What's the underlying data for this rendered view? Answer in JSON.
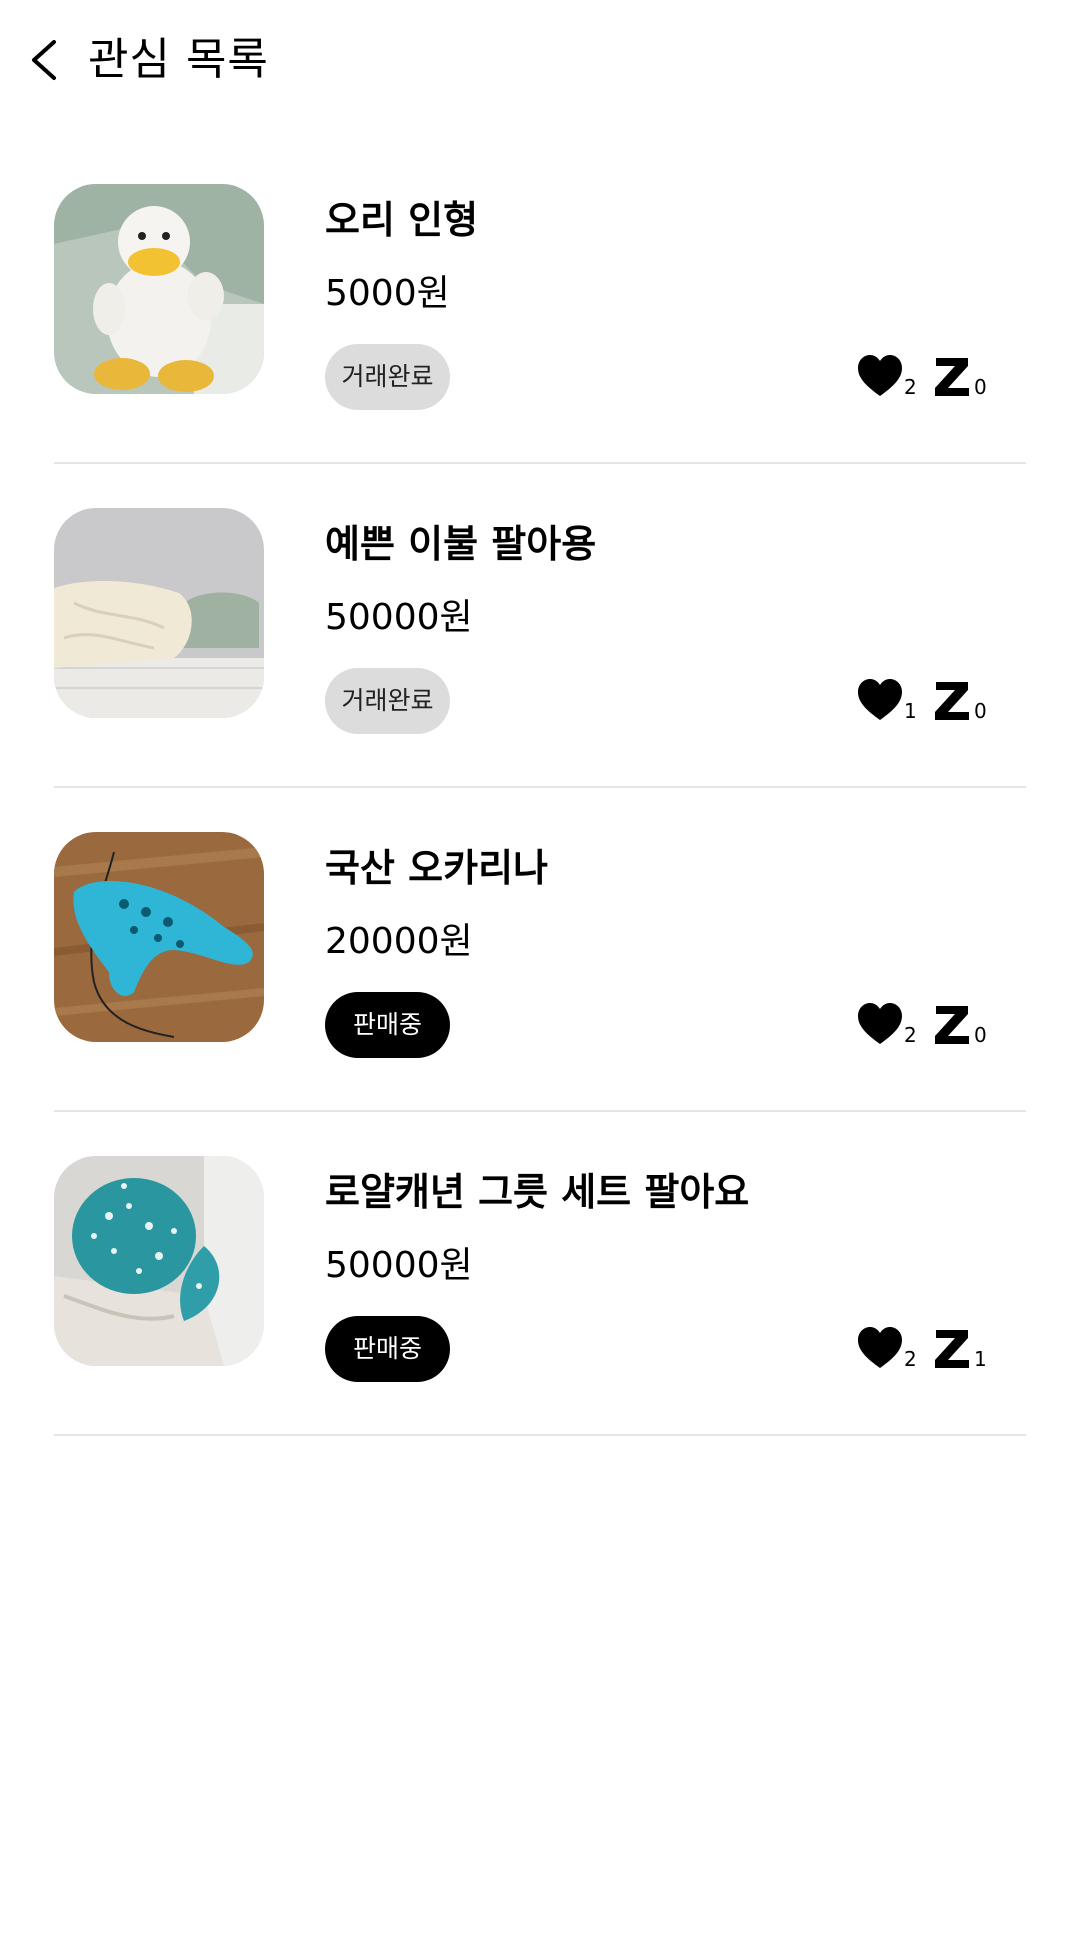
{
  "header": {
    "title": "관심 목록",
    "back_icon": "chevron-left-icon"
  },
  "items": [
    {
      "title": "오리 인형",
      "price": "5000원",
      "status": "거래완료",
      "likes": "2",
      "chats": "0"
    },
    {
      "title": "예쁜 이불 팔아용",
      "price": "50000원",
      "status": "거래완료",
      "likes": "1",
      "chats": "0"
    },
    {
      "title": "국산 오카리나",
      "price": "20000원",
      "status": "판매중",
      "likes": "2",
      "chats": "0"
    },
    {
      "title": "로얄캐년 그릇 세트 팔아요",
      "price": "50000원",
      "status": "판매중",
      "likes": "2",
      "chats": "1"
    }
  ],
  "colors": {
    "badge_done_bg": "#dcdcdc",
    "badge_selling_bg": "#000000",
    "divider": "#e6e6e6"
  }
}
